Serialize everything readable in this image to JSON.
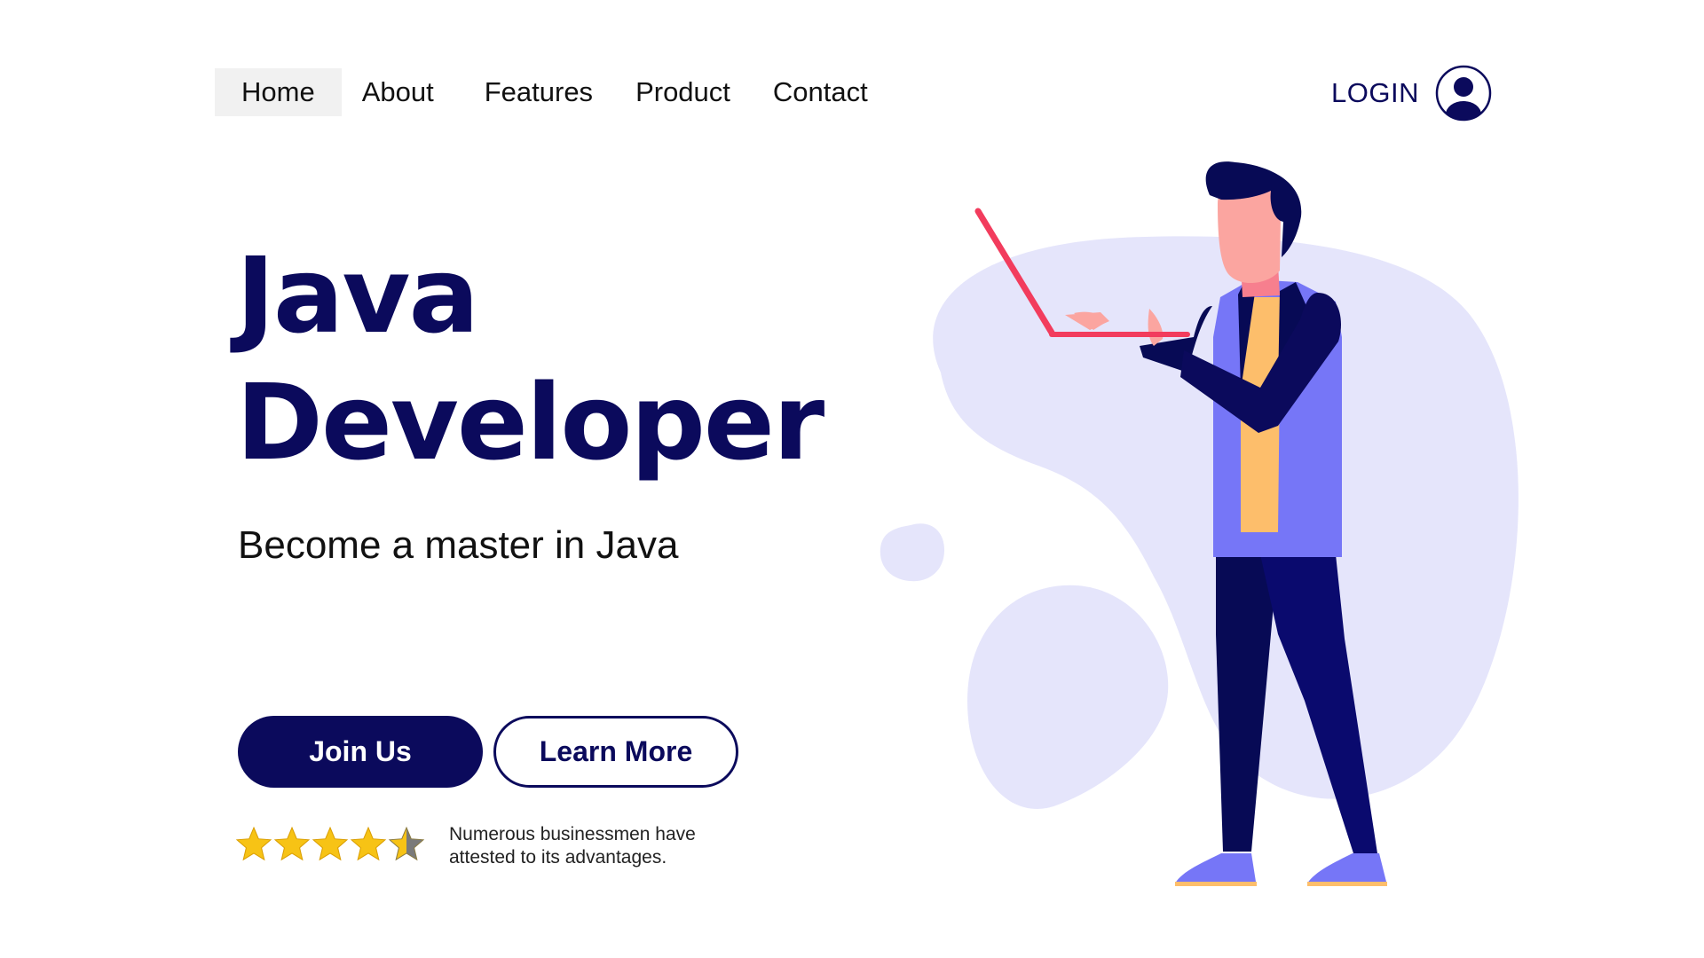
{
  "nav": {
    "items": [
      {
        "label": "Home",
        "active": true
      },
      {
        "label": "About"
      },
      {
        "label": "Features"
      },
      {
        "label": "Product"
      },
      {
        "label": "Contact"
      }
    ],
    "login_label": "LOGIN",
    "login_icon": "user-circle-icon"
  },
  "hero": {
    "title_line1": "Java",
    "title_line2": "Developer",
    "subtitle": "Become a master in Java"
  },
  "buttons": {
    "join_label": "Join Us",
    "learn_label": "Learn More"
  },
  "rating": {
    "value": 4.5,
    "max": 5,
    "text": "Numerous businessmen have attested to its advantages."
  },
  "colors": {
    "brand_navy": "#0b0a5c",
    "blob_lavender": "#e5e5fb",
    "star_gold": "#f7c315",
    "laptop_red": "#f23c5d",
    "vest_purple": "#7676f7",
    "shirt_yellow": "#fdbe6b"
  }
}
